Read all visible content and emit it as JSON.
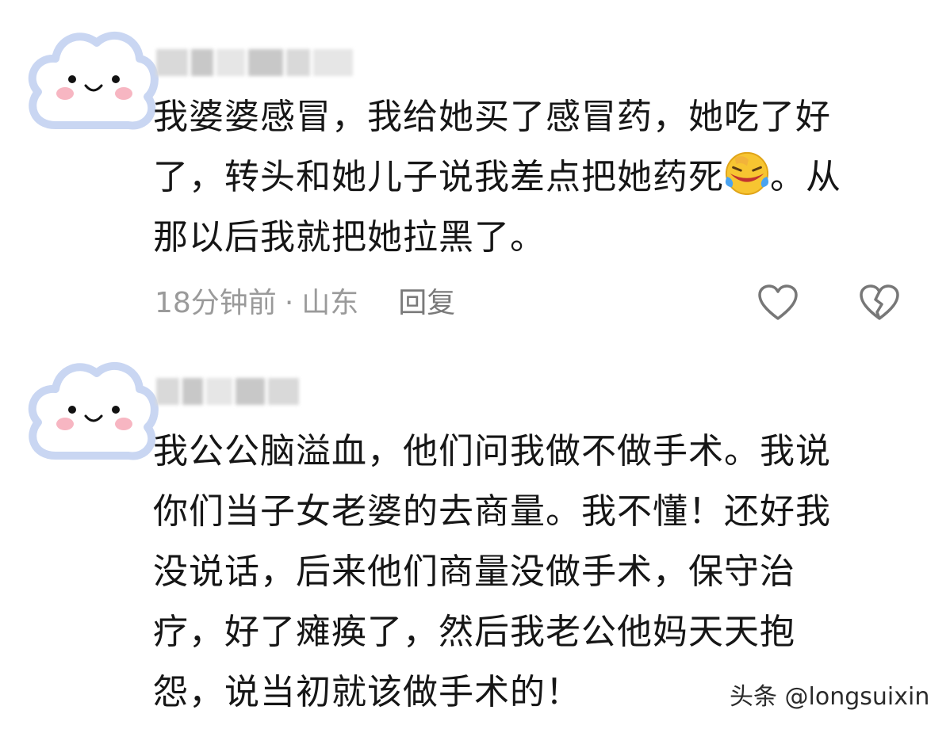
{
  "comments": [
    {
      "lines": [
        "我婆婆感冒，我给她买了感冒药，她吃了好",
        "了，转头和她儿子说我差点把她药死",
        "那以后我就把她拉黑了。"
      ],
      "line2_tail": "。从",
      "emoji": "laughing-crying-emoji",
      "time": "18分钟前",
      "separator": "·",
      "location": "山东",
      "reply_label": "回复",
      "like_icon": "heart-icon",
      "dislike_icon": "broken-heart-icon"
    },
    {
      "lines": [
        "我公公脑溢血，他们问我做不做手术。我说",
        "你们当子女老婆的去商量。我不懂！还好我",
        "没说话，后来他们商量没做手术，保守治",
        "疗，好了瘫痪了，然后我老公他妈天天抱",
        "怨，说当初就该做手术的！"
      ]
    }
  ],
  "watermark": "头条 @longsuixin",
  "colors": {
    "avatar_cloud": "#ffffff",
    "avatar_outline": "#c9d6f2",
    "avatar_cheek": "#f7b6c2",
    "meta_text": "#9a9a9a",
    "body_text": "#161616"
  }
}
